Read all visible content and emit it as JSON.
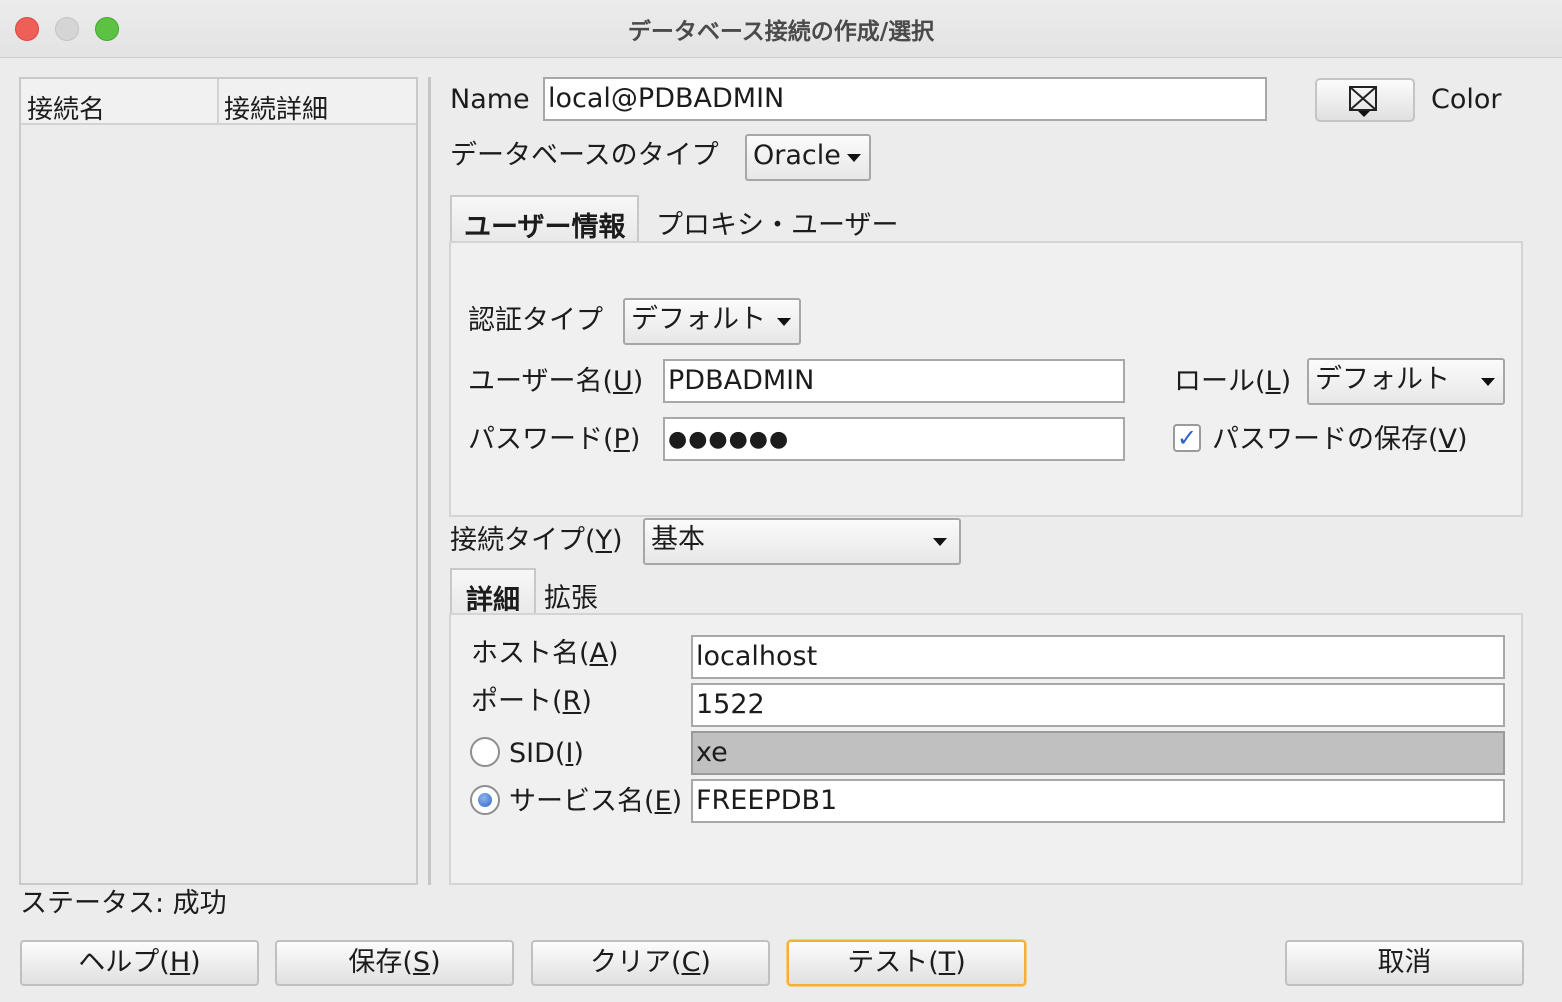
{
  "window": {
    "title": "データベース接続の作成/選択"
  },
  "connection_list": {
    "col_name": "接続名",
    "col_details": "接続詳細"
  },
  "form": {
    "name_label": "Name",
    "name_value": "local@PDBADMIN",
    "color_label": "Color",
    "dbtype_label": "データベースのタイプ",
    "dbtype_value": "Oracle",
    "tabs": {
      "user_info": "ユーザー情報",
      "proxy_user": "プロキシ・ユーザー"
    },
    "auth_type_label": "認証タイプ",
    "auth_type_value": "デフォルト",
    "username_label": "ユーザー名(",
    "username_mnemonic": "U",
    "username_close": ")",
    "username_value": "PDBADMIN",
    "role_label": "ロール(",
    "role_mnemonic": "L",
    "role_close": ")",
    "role_value": "デフォルト",
    "password_label": "パスワード(",
    "password_mnemonic": "P",
    "password_close": ")",
    "password_value": "●●●●●●",
    "save_password_label": "パスワードの保存(",
    "save_password_mnemonic": "V",
    "save_password_close": ")",
    "save_password_checked": true,
    "conn_type_label": "接続タイプ(",
    "conn_type_mnemonic": "Y",
    "conn_type_close": ")",
    "conn_type_value": "基本",
    "detail_tabs": {
      "details": "詳細",
      "advanced": "拡張"
    },
    "host_label": "ホスト名(",
    "host_mnemonic": "A",
    "host_close": ")",
    "host_value": "localhost",
    "port_label": "ポート(",
    "port_mnemonic": "R",
    "port_close": ")",
    "port_value": "1522",
    "sid_label": "SID(",
    "sid_mnemonic": "I",
    "sid_close": ")",
    "sid_value": "xe",
    "service_label": "サービス名(",
    "service_mnemonic": "E",
    "service_close": ")",
    "service_value": "FREEPDB1",
    "selected_radio": "service"
  },
  "status": {
    "text": "ステータス: 成功"
  },
  "buttons": {
    "help": "ヘルプ(",
    "help_m": "H",
    "save": "保存(",
    "save_m": "S",
    "clear": "クリア(",
    "clear_m": "C",
    "test": "テスト(",
    "test_m": "T",
    "close": ")",
    "cancel": "取消"
  }
}
